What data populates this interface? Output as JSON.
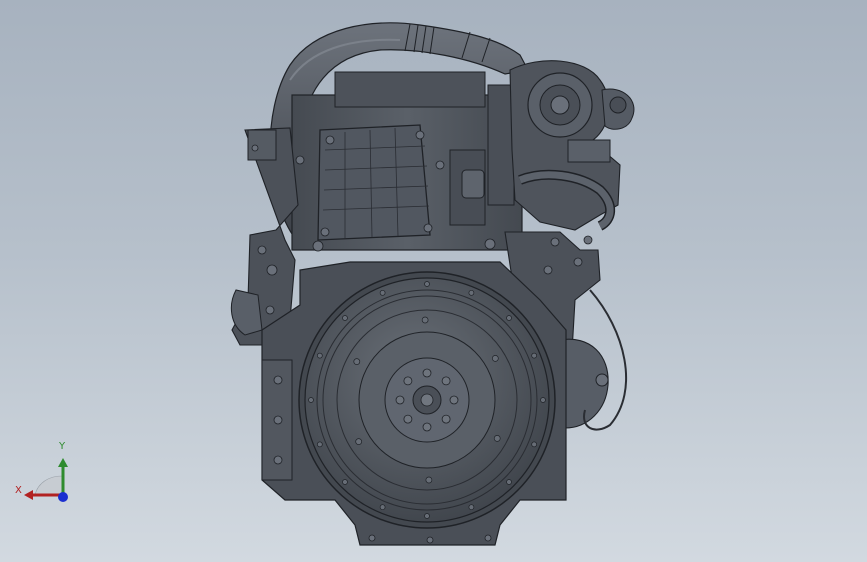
{
  "viewport": {
    "background_top": "#a7b2bf",
    "background_bottom": "#d2d9e0",
    "model": {
      "description_icon": "engine-model",
      "body_color": "#4b5058",
      "line_color": "#1f2227",
      "highlight_color": "#6c727b"
    }
  },
  "triad": {
    "x_label": "X",
    "y_label": "Y",
    "x_color": "#b22222",
    "y_color": "#2e8b2e",
    "z_color": "#1a2fd0"
  }
}
